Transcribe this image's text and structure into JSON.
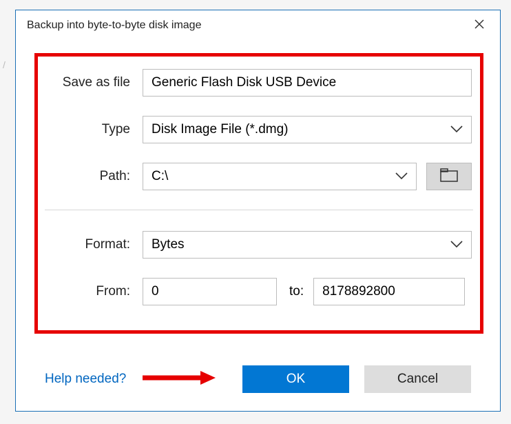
{
  "background": {
    "slash_hint": "/"
  },
  "dialog": {
    "title": "Backup into byte-to-byte disk image",
    "labels": {
      "save_as_file": "Save as file",
      "type": "Type",
      "path": "Path:",
      "format": "Format:",
      "from": "From:",
      "to": "to:"
    },
    "fields": {
      "save_as_file_value": "Generic Flash Disk USB Device",
      "type_value": "Disk Image File (*.dmg)",
      "path_value": "C:\\",
      "format_value": "Bytes",
      "from_value": "0",
      "to_value": "8178892800"
    },
    "help_link": "Help needed?",
    "buttons": {
      "ok": "OK",
      "cancel": "Cancel"
    }
  }
}
